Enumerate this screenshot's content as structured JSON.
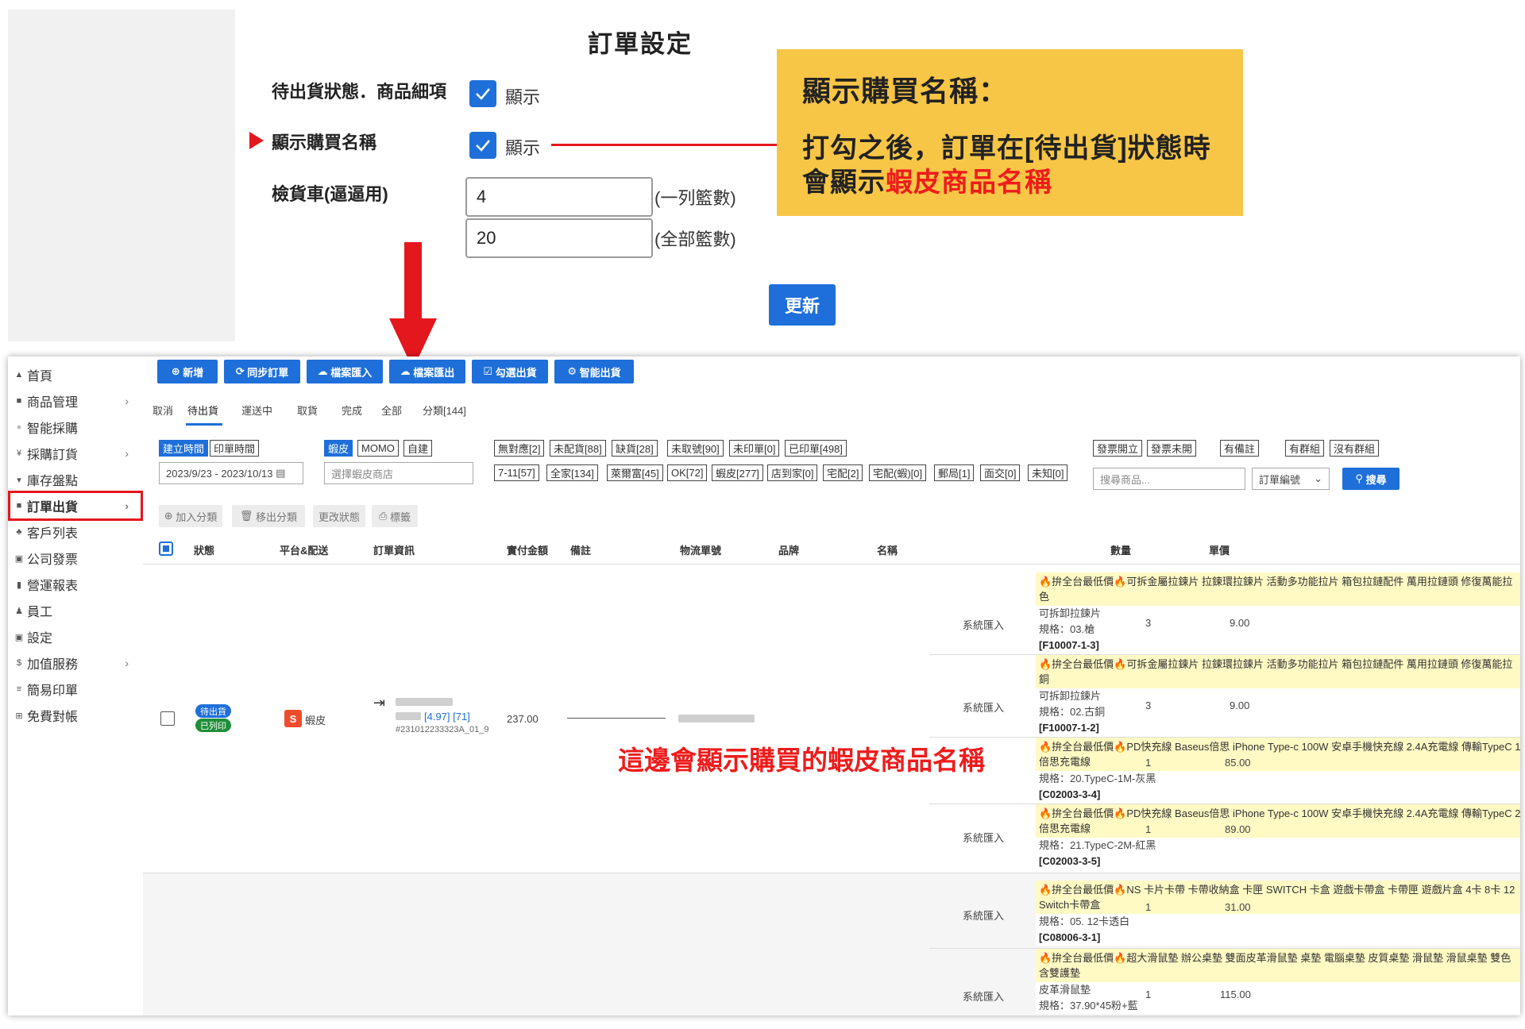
{
  "settings": {
    "title": "訂單設定",
    "row1_label": "待出貨狀態．商品細項",
    "row1_checkbox": "顯示",
    "row2_label": "顯示購買名稱",
    "row2_checkbox": "顯示",
    "row3_label": "檢貨車(逼逼用)",
    "basket_per_row": "4",
    "basket_per_row_hint": "(一列籃數)",
    "basket_total": "20",
    "basket_total_hint": "(全部籃數)",
    "update_button": "更新"
  },
  "callout": {
    "title": "顯示購買名稱：",
    "line1": "打勾之後，訂單在[待出貨]狀態時",
    "line2_prefix": "會顯示",
    "line2_highlight": "蝦皮商品名稱"
  },
  "annotation": "這邊會顯示購買的蝦皮商品名稱",
  "colors": {
    "accent": "#1e6fd9",
    "annotation_red": "#e4171d",
    "callout_bg": "#f7c646",
    "highlight_row": "#fff9c4"
  },
  "sidebar": {
    "items": [
      {
        "icon": "home-icon",
        "label": "首頁"
      },
      {
        "icon": "box-icon",
        "label": "商品管理"
      },
      {
        "icon": "dot-icon",
        "label": "智能採購"
      },
      {
        "icon": "cart-icon",
        "label": "採購訂貨"
      },
      {
        "icon": "flag-icon",
        "label": "庫存盤點"
      },
      {
        "icon": "truck-icon",
        "label": "訂單出貨"
      },
      {
        "icon": "users-icon",
        "label": "客戶列表"
      },
      {
        "icon": "invoice-icon",
        "label": "公司發票"
      },
      {
        "icon": "chart-icon",
        "label": "營運報表"
      },
      {
        "icon": "person-icon",
        "label": "員工"
      },
      {
        "icon": "settings-icon",
        "label": "設定"
      },
      {
        "icon": "dollar-icon",
        "label": "加值服務"
      },
      {
        "icon": "list-icon",
        "label": "簡易印單"
      },
      {
        "icon": "grid-icon",
        "label": "免費對帳"
      }
    ]
  },
  "toolbar": {
    "add": "新增",
    "sync": "同步訂單",
    "import": "檔案匯入",
    "export": "檔案匯出",
    "pick": "勾選出貨",
    "smart": "智能出貨"
  },
  "tabs": [
    "取消",
    "待出貨",
    "運送中",
    "取貨",
    "完成",
    "全部",
    "分類[144]"
  ],
  "filters": {
    "time_create": "建立時間",
    "time_print": "印單時間",
    "date_range": "2023/9/23 - 2023/10/13",
    "platform_shopee": "蝦皮",
    "platform_momo": "MOMO",
    "platform_self": "自建",
    "shop_placeholder": "選擇蝦皮商店",
    "row1": [
      "無對應[2]",
      "未配貨[88]",
      "缺貨[28]",
      "未取號[90]",
      "未印單[0]",
      "已印單[498]"
    ],
    "row2": [
      "7-11[57]",
      "全家[134]",
      "萊爾富[45]",
      "OK[72]",
      "蝦皮[277]",
      "店到家[0]",
      "宅配[2]",
      "宅配(蝦)[0]",
      "郵局[1]",
      "面交[0]",
      "未知[0]"
    ],
    "invoice_open": "發票開立",
    "invoice_none": "發票未開",
    "has_note": "有備註",
    "has_group": "有群組",
    "no_group": "沒有群組",
    "search_placeholder": "搜尋商品...",
    "search_field": "訂單編號",
    "search_button": "搜尋"
  },
  "actions": {
    "add_category": "加入分類",
    "remove_category": "移出分類",
    "change_status": "更改狀態",
    "label": "標籤"
  },
  "table": {
    "headers": [
      "狀態",
      "平台&配送",
      "訂單資訊",
      "實付金額",
      "備註",
      "物流單號",
      "品牌",
      "名稱",
      "數量",
      "單價"
    ],
    "order": {
      "status_pending": "待出貨",
      "status_printed": "已列印",
      "platform": "蝦皮",
      "rating": "[4.97]",
      "rating_count": "[71]",
      "order_no": "#231012233323A_01_9",
      "amount": "237.00"
    },
    "items": [
      {
        "source": "系統匯入",
        "title": "🔥拚全台最低價🔥可拆金屬拉鍊片 拉鍊環拉鍊片 活動多功能拉片 箱包拉鏈配件 萬用拉鏈頭 修復萬能拉",
        "title2": "色",
        "name": "可拆卸拉鍊片",
        "spec": "規格：03.槍",
        "code": "[F10007-1-3]",
        "qty": "3",
        "price": "9.00"
      },
      {
        "source": "系統匯入",
        "title": "🔥拚全台最低價🔥可拆金屬拉鍊片 拉鍊環拉鍊片 活動多功能拉片 箱包拉鏈配件 萬用拉鏈頭 修復萬能拉",
        "title2": "銅",
        "name": "可拆卸拉鍊片",
        "spec": "規格：02.古銅",
        "code": "[F10007-1-2]",
        "qty": "3",
        "price": "9.00"
      },
      {
        "source": "",
        "title": "🔥拚全台最低價🔥PD快充線 Baseus倍思 iPhone Type-c 100W 安卓手機快充線 2.4A充電線 傳輸TypeC 1",
        "title2": "倍思充電線",
        "name": "",
        "spec": "規格：20.TypeC-1M-灰黑",
        "code": "[C02003-3-4]",
        "qty": "1",
        "price": "85.00"
      },
      {
        "source": "系統匯入",
        "title": "🔥拚全台最低價🔥PD快充線 Baseus倍思 iPhone Type-c 100W 安卓手機快充線 2.4A充電線 傳輸TypeC 2",
        "title2": "倍思充電線",
        "name": "",
        "spec": "規格：21.TypeC-2M-紅黑",
        "code": "[C02003-3-5]",
        "qty": "1",
        "price": "89.00"
      },
      {
        "source": "系統匯入",
        "title": "🔥拚全台最低價🔥NS 卡片卡帶 卡帶收納盒 卡匣 SWITCH 卡盒 遊戲卡帶盒 卡帶匣 遊戲片盒 4卡 8卡 12",
        "title2": "Switch卡帶盒",
        "name": "",
        "spec": "規格：05. 12卡透白",
        "code": "[C08006-3-1]",
        "qty": "1",
        "price": "31.00"
      },
      {
        "source": "系統匯入",
        "title": "🔥拚全台最低價🔥超大滑鼠墊 辦公桌墊 雙面皮革滑鼠墊 桌墊 電腦桌墊 皮質桌墊 滑鼠墊 滑鼠桌墊 雙色",
        "title2": "含雙護墊",
        "name": "皮革滑鼠墊",
        "spec": "規格：37.90*45粉+藍",
        "code": "",
        "qty": "1",
        "price": "115.00"
      }
    ]
  }
}
